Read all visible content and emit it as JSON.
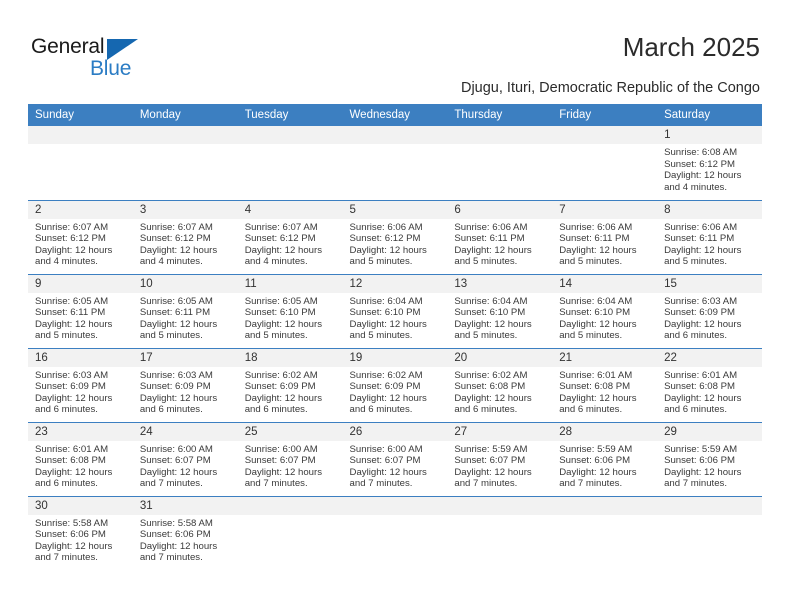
{
  "brand": {
    "name_top": "General",
    "name_bottom": "Blue",
    "accent_color": "#1567b0",
    "blue_text_color": "#2b7cc4",
    "triangle_icon": "triangle-right-icon"
  },
  "header": {
    "title": "March 2025",
    "subtitle": "Djugu, Ituri, Democratic Republic of the Congo"
  },
  "calendar": {
    "header_bg": "#3c7fc1",
    "header_text_color": "#ffffff",
    "datenum_bg": "#f2f2f2",
    "weekday_headers": [
      "Sunday",
      "Monday",
      "Tuesday",
      "Wednesday",
      "Thursday",
      "Friday",
      "Saturday"
    ],
    "weeks": [
      [
        {
          "day": "",
          "sunrise": "",
          "sunset": "",
          "daylight_1": "",
          "daylight_2": ""
        },
        {
          "day": "",
          "sunrise": "",
          "sunset": "",
          "daylight_1": "",
          "daylight_2": ""
        },
        {
          "day": "",
          "sunrise": "",
          "sunset": "",
          "daylight_1": "",
          "daylight_2": ""
        },
        {
          "day": "",
          "sunrise": "",
          "sunset": "",
          "daylight_1": "",
          "daylight_2": ""
        },
        {
          "day": "",
          "sunrise": "",
          "sunset": "",
          "daylight_1": "",
          "daylight_2": ""
        },
        {
          "day": "",
          "sunrise": "",
          "sunset": "",
          "daylight_1": "",
          "daylight_2": ""
        },
        {
          "day": "1",
          "sunrise": "Sunrise: 6:08 AM",
          "sunset": "Sunset: 6:12 PM",
          "daylight_1": "Daylight: 12 hours",
          "daylight_2": "and 4 minutes."
        }
      ],
      [
        {
          "day": "2",
          "sunrise": "Sunrise: 6:07 AM",
          "sunset": "Sunset: 6:12 PM",
          "daylight_1": "Daylight: 12 hours",
          "daylight_2": "and 4 minutes."
        },
        {
          "day": "3",
          "sunrise": "Sunrise: 6:07 AM",
          "sunset": "Sunset: 6:12 PM",
          "daylight_1": "Daylight: 12 hours",
          "daylight_2": "and 4 minutes."
        },
        {
          "day": "4",
          "sunrise": "Sunrise: 6:07 AM",
          "sunset": "Sunset: 6:12 PM",
          "daylight_1": "Daylight: 12 hours",
          "daylight_2": "and 4 minutes."
        },
        {
          "day": "5",
          "sunrise": "Sunrise: 6:06 AM",
          "sunset": "Sunset: 6:12 PM",
          "daylight_1": "Daylight: 12 hours",
          "daylight_2": "and 5 minutes."
        },
        {
          "day": "6",
          "sunrise": "Sunrise: 6:06 AM",
          "sunset": "Sunset: 6:11 PM",
          "daylight_1": "Daylight: 12 hours",
          "daylight_2": "and 5 minutes."
        },
        {
          "day": "7",
          "sunrise": "Sunrise: 6:06 AM",
          "sunset": "Sunset: 6:11 PM",
          "daylight_1": "Daylight: 12 hours",
          "daylight_2": "and 5 minutes."
        },
        {
          "day": "8",
          "sunrise": "Sunrise: 6:06 AM",
          "sunset": "Sunset: 6:11 PM",
          "daylight_1": "Daylight: 12 hours",
          "daylight_2": "and 5 minutes."
        }
      ],
      [
        {
          "day": "9",
          "sunrise": "Sunrise: 6:05 AM",
          "sunset": "Sunset: 6:11 PM",
          "daylight_1": "Daylight: 12 hours",
          "daylight_2": "and 5 minutes."
        },
        {
          "day": "10",
          "sunrise": "Sunrise: 6:05 AM",
          "sunset": "Sunset: 6:11 PM",
          "daylight_1": "Daylight: 12 hours",
          "daylight_2": "and 5 minutes."
        },
        {
          "day": "11",
          "sunrise": "Sunrise: 6:05 AM",
          "sunset": "Sunset: 6:10 PM",
          "daylight_1": "Daylight: 12 hours",
          "daylight_2": "and 5 minutes."
        },
        {
          "day": "12",
          "sunrise": "Sunrise: 6:04 AM",
          "sunset": "Sunset: 6:10 PM",
          "daylight_1": "Daylight: 12 hours",
          "daylight_2": "and 5 minutes."
        },
        {
          "day": "13",
          "sunrise": "Sunrise: 6:04 AM",
          "sunset": "Sunset: 6:10 PM",
          "daylight_1": "Daylight: 12 hours",
          "daylight_2": "and 5 minutes."
        },
        {
          "day": "14",
          "sunrise": "Sunrise: 6:04 AM",
          "sunset": "Sunset: 6:10 PM",
          "daylight_1": "Daylight: 12 hours",
          "daylight_2": "and 5 minutes."
        },
        {
          "day": "15",
          "sunrise": "Sunrise: 6:03 AM",
          "sunset": "Sunset: 6:09 PM",
          "daylight_1": "Daylight: 12 hours",
          "daylight_2": "and 6 minutes."
        }
      ],
      [
        {
          "day": "16",
          "sunrise": "Sunrise: 6:03 AM",
          "sunset": "Sunset: 6:09 PM",
          "daylight_1": "Daylight: 12 hours",
          "daylight_2": "and 6 minutes."
        },
        {
          "day": "17",
          "sunrise": "Sunrise: 6:03 AM",
          "sunset": "Sunset: 6:09 PM",
          "daylight_1": "Daylight: 12 hours",
          "daylight_2": "and 6 minutes."
        },
        {
          "day": "18",
          "sunrise": "Sunrise: 6:02 AM",
          "sunset": "Sunset: 6:09 PM",
          "daylight_1": "Daylight: 12 hours",
          "daylight_2": "and 6 minutes."
        },
        {
          "day": "19",
          "sunrise": "Sunrise: 6:02 AM",
          "sunset": "Sunset: 6:09 PM",
          "daylight_1": "Daylight: 12 hours",
          "daylight_2": "and 6 minutes."
        },
        {
          "day": "20",
          "sunrise": "Sunrise: 6:02 AM",
          "sunset": "Sunset: 6:08 PM",
          "daylight_1": "Daylight: 12 hours",
          "daylight_2": "and 6 minutes."
        },
        {
          "day": "21",
          "sunrise": "Sunrise: 6:01 AM",
          "sunset": "Sunset: 6:08 PM",
          "daylight_1": "Daylight: 12 hours",
          "daylight_2": "and 6 minutes."
        },
        {
          "day": "22",
          "sunrise": "Sunrise: 6:01 AM",
          "sunset": "Sunset: 6:08 PM",
          "daylight_1": "Daylight: 12 hours",
          "daylight_2": "and 6 minutes."
        }
      ],
      [
        {
          "day": "23",
          "sunrise": "Sunrise: 6:01 AM",
          "sunset": "Sunset: 6:08 PM",
          "daylight_1": "Daylight: 12 hours",
          "daylight_2": "and 6 minutes."
        },
        {
          "day": "24",
          "sunrise": "Sunrise: 6:00 AM",
          "sunset": "Sunset: 6:07 PM",
          "daylight_1": "Daylight: 12 hours",
          "daylight_2": "and 7 minutes."
        },
        {
          "day": "25",
          "sunrise": "Sunrise: 6:00 AM",
          "sunset": "Sunset: 6:07 PM",
          "daylight_1": "Daylight: 12 hours",
          "daylight_2": "and 7 minutes."
        },
        {
          "day": "26",
          "sunrise": "Sunrise: 6:00 AM",
          "sunset": "Sunset: 6:07 PM",
          "daylight_1": "Daylight: 12 hours",
          "daylight_2": "and 7 minutes."
        },
        {
          "day": "27",
          "sunrise": "Sunrise: 5:59 AM",
          "sunset": "Sunset: 6:07 PM",
          "daylight_1": "Daylight: 12 hours",
          "daylight_2": "and 7 minutes."
        },
        {
          "day": "28",
          "sunrise": "Sunrise: 5:59 AM",
          "sunset": "Sunset: 6:06 PM",
          "daylight_1": "Daylight: 12 hours",
          "daylight_2": "and 7 minutes."
        },
        {
          "day": "29",
          "sunrise": "Sunrise: 5:59 AM",
          "sunset": "Sunset: 6:06 PM",
          "daylight_1": "Daylight: 12 hours",
          "daylight_2": "and 7 minutes."
        }
      ],
      [
        {
          "day": "30",
          "sunrise": "Sunrise: 5:58 AM",
          "sunset": "Sunset: 6:06 PM",
          "daylight_1": "Daylight: 12 hours",
          "daylight_2": "and 7 minutes."
        },
        {
          "day": "31",
          "sunrise": "Sunrise: 5:58 AM",
          "sunset": "Sunset: 6:06 PM",
          "daylight_1": "Daylight: 12 hours",
          "daylight_2": "and 7 minutes."
        },
        {
          "day": "",
          "sunrise": "",
          "sunset": "",
          "daylight_1": "",
          "daylight_2": ""
        },
        {
          "day": "",
          "sunrise": "",
          "sunset": "",
          "daylight_1": "",
          "daylight_2": ""
        },
        {
          "day": "",
          "sunrise": "",
          "sunset": "",
          "daylight_1": "",
          "daylight_2": ""
        },
        {
          "day": "",
          "sunrise": "",
          "sunset": "",
          "daylight_1": "",
          "daylight_2": ""
        },
        {
          "day": "",
          "sunrise": "",
          "sunset": "",
          "daylight_1": "",
          "daylight_2": ""
        }
      ]
    ]
  }
}
